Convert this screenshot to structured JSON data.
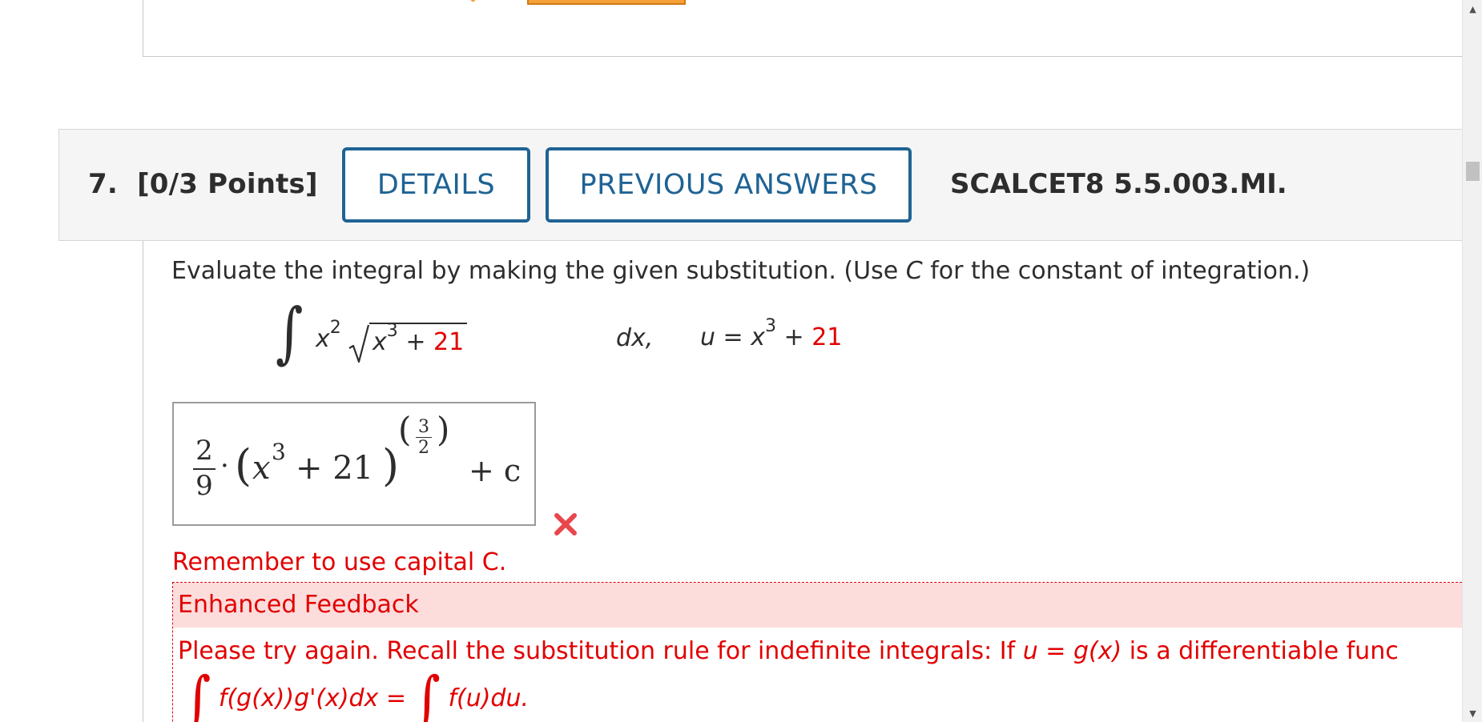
{
  "question": {
    "number": "7.",
    "points": "[0/3 Points]",
    "details_label": "DETAILS",
    "previous_answers_label": "PREVIOUS ANSWERS",
    "code": "SCALCET8 5.5.003.MI."
  },
  "prompt": {
    "before": "Evaluate the integral by making the given substitution. (Use ",
    "var": "C",
    "after": " for the constant of integration.)"
  },
  "integral": {
    "integrand_base": "x",
    "integrand_exp": "2",
    "radicand_var": "x",
    "radicand_exp": "3",
    "radicand_plus": "+",
    "radicand_const": "21",
    "differential": "dx,",
    "sub_lhs": "u = x",
    "sub_exp": "3",
    "sub_plus": "+",
    "sub_const": "21"
  },
  "answer": {
    "coef_num": "2",
    "coef_den": "9",
    "dot": "·",
    "inner_var": "x",
    "inner_exp": "3",
    "inner_rest": "+ 21",
    "outer_exp_num": "3",
    "outer_exp_den": "2",
    "plus_c": "+ c",
    "status_icon": "wrong-x-icon"
  },
  "hint": "Remember to use capital C.",
  "feedback": {
    "header": "Enhanced Feedback",
    "text_before": "Please try again. Recall the substitution rule for indefinite integrals: If ",
    "text_u": "u",
    "text_eq": " = ",
    "text_g": "g",
    "text_x": "(x)",
    "text_after": "  is a differentiable func",
    "formula_left": "f(g(x))g'(x)dx =",
    "formula_right": "f(u)du."
  },
  "colors": {
    "accent_blue": "#1f6394",
    "error_red": "#e10000",
    "feedback_bg": "#fddcdc",
    "header_bg": "#f5f5f5"
  }
}
